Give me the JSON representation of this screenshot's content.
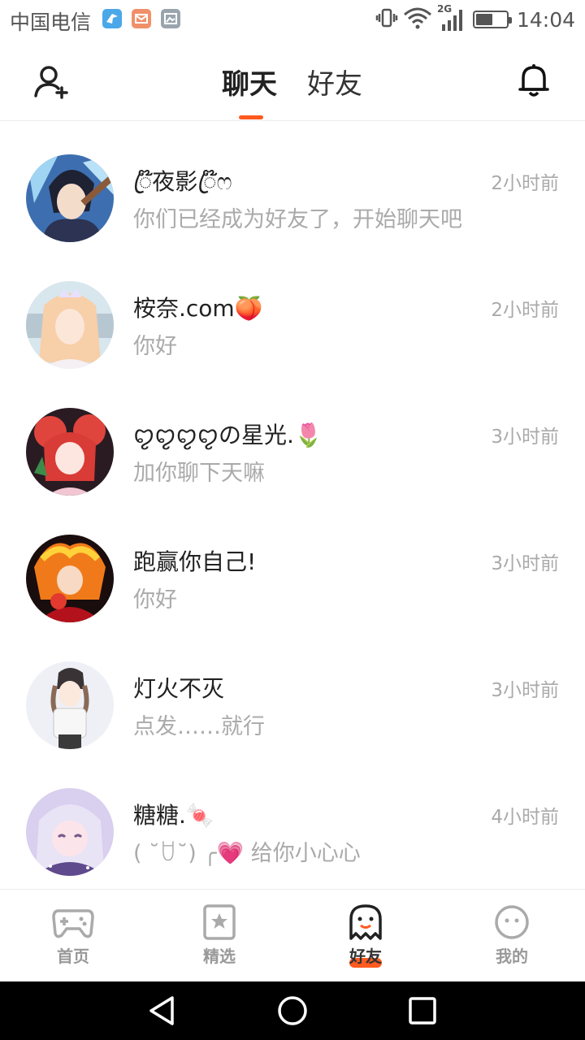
{
  "status_bar": {
    "carrier": "中国电信",
    "network": "2G",
    "time": "14:04",
    "battery_level": 0.55,
    "app_icons": [
      "bird-app-icon",
      "mail-app-icon",
      "gallery-app-icon"
    ]
  },
  "header": {
    "tabs": [
      {
        "label": "聊天",
        "active": true
      },
      {
        "label": "好友",
        "active": false
      }
    ],
    "icons": {
      "left": "add-friend-icon",
      "right": "bell-icon"
    },
    "accent": "#ff5a1f"
  },
  "chats": [
    {
      "name": "ꦿ໊夜影ꦿ໊ෆ",
      "message": "你们已经成为好友了，开始聊天吧",
      "time": "2小时前"
    },
    {
      "name": "桉奈.com🍑",
      "message": "你好",
      "time": "2小时前"
    },
    {
      "name": "ꨄꨄꨄꨄの星光.🌷",
      "message": "加你聊下天嘛",
      "time": "3小时前"
    },
    {
      "name": "跑赢你自己!",
      "message": "你好",
      "time": "3小时前"
    },
    {
      "name": "灯火不灭",
      "message": " 点发……就行",
      "time": "3小时前"
    },
    {
      "name": "糖糖.🍬",
      "message": "( ˘ꇴ˘) ╭💗 给你小心心",
      "time": "4小时前"
    }
  ],
  "bottom_nav": [
    {
      "label": "首页",
      "icon": "gamepad-icon",
      "active": false
    },
    {
      "label": "精选",
      "icon": "star-bookmark-icon",
      "active": false
    },
    {
      "label": "好友",
      "icon": "ghost-icon",
      "active": true
    },
    {
      "label": "我的",
      "icon": "smiley-icon",
      "active": false
    }
  ],
  "system_nav": [
    "back-icon",
    "home-icon",
    "recents-icon"
  ]
}
